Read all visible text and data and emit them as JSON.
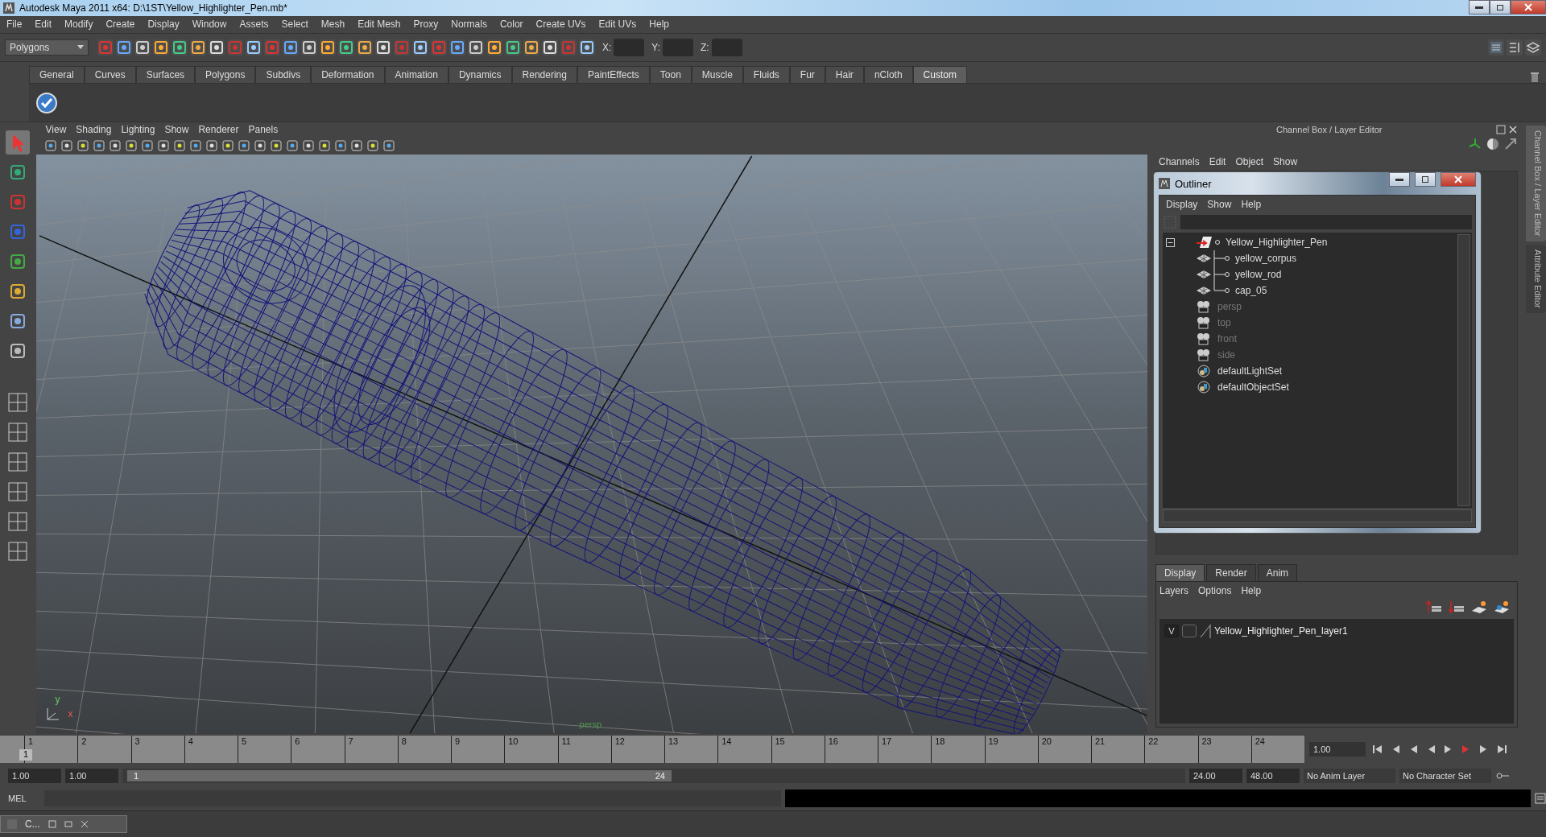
{
  "window": {
    "title": "Autodesk Maya 2011 x64: D:\\1ST\\Yellow_Highlighter_Pen.mb*"
  },
  "menu_bar": [
    "File",
    "Edit",
    "Modify",
    "Create",
    "Display",
    "Window",
    "Assets",
    "Select",
    "Mesh",
    "Edit Mesh",
    "Proxy",
    "Normals",
    "Color",
    "Create UVs",
    "Edit UVs",
    "Help"
  ],
  "toolbar": {
    "mode": "Polygons",
    "x_label": "X:",
    "y_label": "Y:",
    "z_label": "Z:"
  },
  "shelf_tabs": [
    {
      "label": "General",
      "selected": false
    },
    {
      "label": "Curves",
      "selected": false
    },
    {
      "label": "Surfaces",
      "selected": false
    },
    {
      "label": "Polygons",
      "selected": false
    },
    {
      "label": "Subdivs",
      "selected": false
    },
    {
      "label": "Deformation",
      "selected": false
    },
    {
      "label": "Animation",
      "selected": false
    },
    {
      "label": "Dynamics",
      "selected": false
    },
    {
      "label": "Rendering",
      "selected": false
    },
    {
      "label": "PaintEffects",
      "selected": false
    },
    {
      "label": "Toon",
      "selected": false
    },
    {
      "label": "Muscle",
      "selected": false
    },
    {
      "label": "Fluids",
      "selected": false
    },
    {
      "label": "Fur",
      "selected": false
    },
    {
      "label": "Hair",
      "selected": false
    },
    {
      "label": "nCloth",
      "selected": false
    },
    {
      "label": "Custom",
      "selected": true
    }
  ],
  "viewport": {
    "menu": [
      "View",
      "Shading",
      "Lighting",
      "Show",
      "Renderer",
      "Panels"
    ],
    "camera_label": "persp",
    "axis_y": "y",
    "axis_x": "x"
  },
  "channel_box": {
    "title": "Channel Box / Layer Editor",
    "menu": [
      "Channels",
      "Edit",
      "Object",
      "Show"
    ]
  },
  "side_tabs": [
    {
      "label": "Channel Box / Layer Editor",
      "selected": true
    },
    {
      "label": "Attribute Editor",
      "selected": false
    }
  ],
  "outliner": {
    "title": "Outliner",
    "menu": [
      "Display",
      "Show",
      "Help"
    ],
    "items": [
      {
        "label": "Yellow_Highlighter_Pen",
        "kind": "group",
        "dimmed": false,
        "expanded": true,
        "children": [
          {
            "label": "yellow_corpus",
            "kind": "mesh",
            "dimmed": false
          },
          {
            "label": "yellow_rod",
            "kind": "mesh",
            "dimmed": false
          },
          {
            "label": "cap_05",
            "kind": "mesh",
            "dimmed": false
          }
        ]
      },
      {
        "label": "persp",
        "kind": "camera",
        "dimmed": true
      },
      {
        "label": "top",
        "kind": "camera",
        "dimmed": true
      },
      {
        "label": "front",
        "kind": "camera",
        "dimmed": true
      },
      {
        "label": "side",
        "kind": "camera",
        "dimmed": true
      },
      {
        "label": "defaultLightSet",
        "kind": "set",
        "dimmed": false
      },
      {
        "label": "defaultObjectSet",
        "kind": "set",
        "dimmed": false
      }
    ]
  },
  "layer_editor": {
    "tabs": [
      {
        "label": "Display",
        "selected": true
      },
      {
        "label": "Render",
        "selected": false
      },
      {
        "label": "Anim",
        "selected": false
      }
    ],
    "menu": [
      "Layers",
      "Options",
      "Help"
    ],
    "layers": [
      {
        "visibility": "V",
        "name": "Yellow_Highlighter_Pen_layer1"
      }
    ]
  },
  "timeline": {
    "ticks": [
      "1",
      "2",
      "3",
      "4",
      "5",
      "6",
      "7",
      "8",
      "9",
      "10",
      "11",
      "12",
      "13",
      "14",
      "15",
      "16",
      "17",
      "18",
      "19",
      "20",
      "21",
      "22",
      "23",
      "24"
    ],
    "current_frame": "1",
    "current_time": "1.00"
  },
  "range": {
    "level": 0.5,
    "start": "1.00",
    "playback_start": "1.00",
    "slider_start": "1",
    "slider_end": "24",
    "playback_end": "24.00",
    "end": "48.00",
    "anim_layer": "No Anim Layer",
    "character_set": "No Character Set"
  },
  "command_line": {
    "label": "MEL"
  },
  "taskbar": {
    "label": "C..."
  }
}
